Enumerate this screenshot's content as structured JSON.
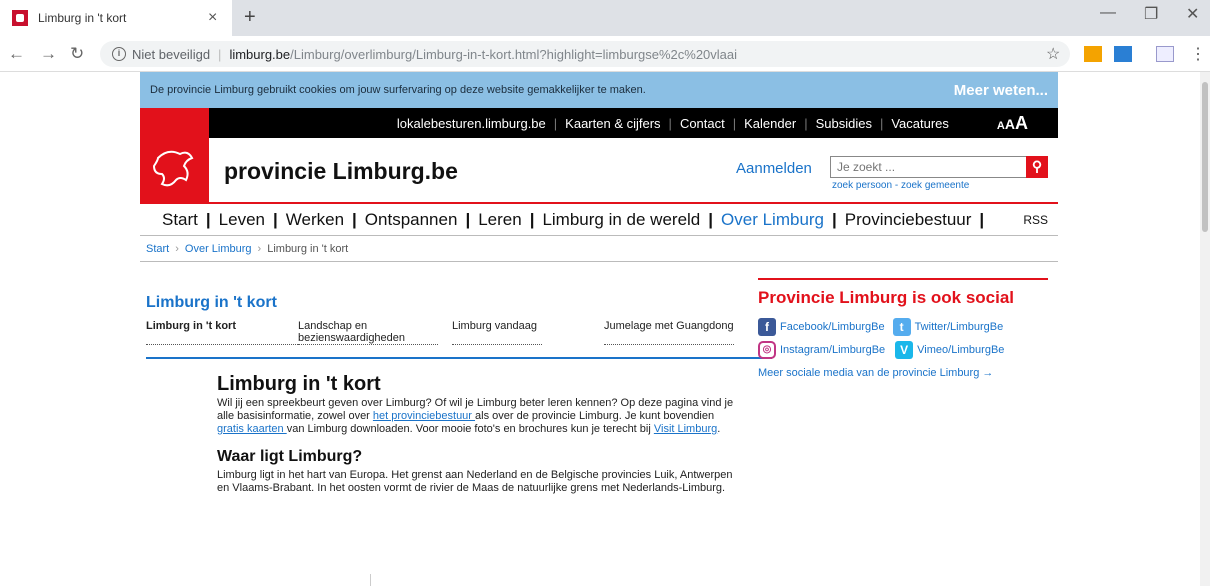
{
  "browser": {
    "tab_title": "Limburg in 't kort",
    "tab_close": "×",
    "new_tab": "+",
    "not_secure": "Niet beveiligd",
    "url_host": "limburg.be",
    "url_path": "/Limburg/overlimburg/Limburg-in-t-kort.html?highlight=limburgse%2c%20vlaai",
    "window_controls": [
      "—",
      "❐",
      "✕"
    ]
  },
  "cookie_bar": {
    "text": "De provincie Limburg gebruikt cookies om jouw surfervaring op deze website gemakkelijker te maken.",
    "more": "Meer weten..."
  },
  "top_links": [
    "lokalebesturen.limburg.be",
    "Kaarten & cijfers",
    "Contact",
    "Kalender",
    "Subsidies",
    "Vacatures"
  ],
  "font_size_control": [
    "A",
    "A",
    "A"
  ],
  "brand": "provincie Limburg.be",
  "login": "Aanmelden",
  "search": {
    "placeholder": "Je zoekt ...",
    "sub_person": "zoek persoon",
    "sub_dash": " - ",
    "sub_municipality": "zoek gemeente"
  },
  "main_nav": [
    "Start",
    "Leven",
    "Werken",
    "Ontspannen",
    "Leren",
    "Limburg in de wereld",
    "Over Limburg",
    "Provinciebestuur"
  ],
  "rss": "RSS",
  "breadcrumb": [
    "Start",
    "Over Limburg",
    "Limburg in 't kort"
  ],
  "section": {
    "title": "Limburg in 't kort",
    "subnav": [
      "Limburg in 't kort",
      "Landschap en bezienswaardigheden",
      "Limburg vandaag",
      "Jumelage met Guangdong"
    ]
  },
  "article": {
    "h1": "Limburg in 't kort",
    "p1_a": "Wil jij een spreekbeurt geven over Limburg? Of wil je Limburg beter leren kennen? Op deze pagina vind je alle basisinformatie, zowel over ",
    "p1_link1": "het provinciebestuur ",
    "p1_b": "als over de provincie Limburg. Je kunt bovendien ",
    "p1_link2": "gratis kaarten ",
    "p1_c": "van Limburg downloaden. Voor mooie foto's en brochures kun je terecht bij ",
    "p1_link3": "Visit Limburg",
    "p1_d": ".",
    "h2": "Waar ligt Limburg?",
    "p2": "Limburg ligt in het hart van Europa. Het grenst aan Nederland en de Belgische provincies Luik, Antwerpen en Vlaams-Brabant. In het oosten vormt de rivier de Maas de natuurlijke grens met Nederlands-Limburg."
  },
  "social": {
    "title": "Provincie Limburg is ook social",
    "facebook": "Facebook/LimburgBe",
    "twitter": "Twitter/LimburgBe",
    "instagram": "Instagram/LimburgBe",
    "vimeo": "Vimeo/LimburgBe",
    "more": "Meer sociale media van de provincie Limburg →"
  },
  "colors": {
    "brand_red": "#e2111b",
    "link_blue": "#1a73c9",
    "cookie_blue": "#8bbfe4"
  }
}
